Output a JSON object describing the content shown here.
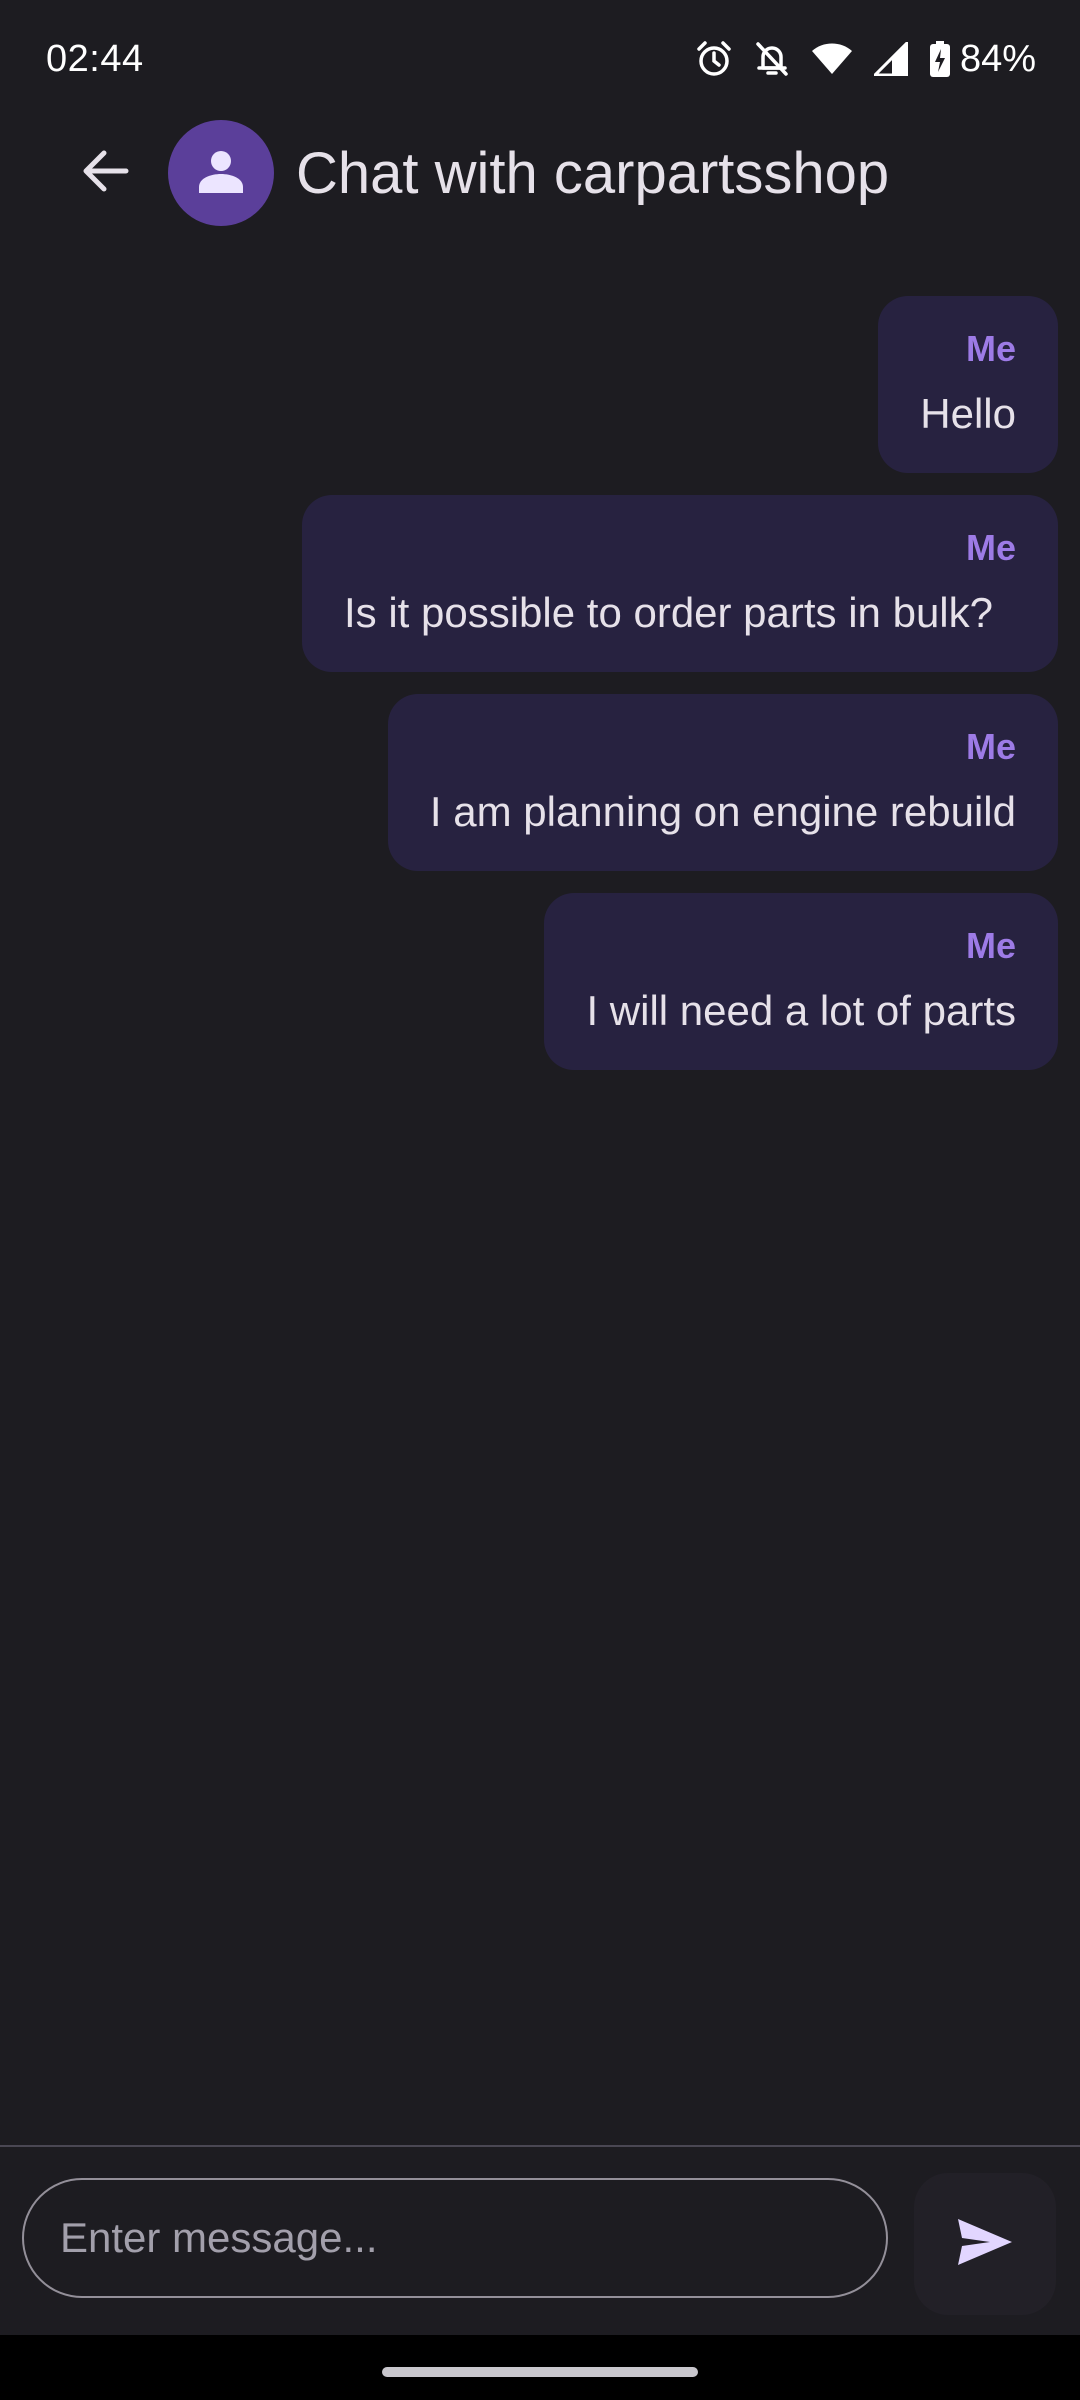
{
  "status_bar": {
    "time": "02:44",
    "battery": "84%",
    "icons": [
      "alarm-icon",
      "notifications-off-icon",
      "wifi-icon",
      "cellular-signal-icon",
      "battery-charging-icon"
    ]
  },
  "app_bar": {
    "title": "Chat with carpartsshop",
    "back_icon": "arrow-back-icon",
    "avatar_icon": "person-icon"
  },
  "messages": [
    {
      "sender": "Me",
      "text": "Hello"
    },
    {
      "sender": "Me",
      "text": "Is it possible to order parts in bulk?"
    },
    {
      "sender": "Me",
      "text": "I am planning on engine rebuild"
    },
    {
      "sender": "Me",
      "text": "I will need a lot of parts"
    }
  ],
  "composer": {
    "placeholder": "Enter message...",
    "value": "",
    "send_icon": "send-icon"
  },
  "colors": {
    "background": "#1d1c21",
    "bubble": "#272240",
    "sender_accent": "#9d7be6",
    "avatar": "#5b3f9a"
  }
}
